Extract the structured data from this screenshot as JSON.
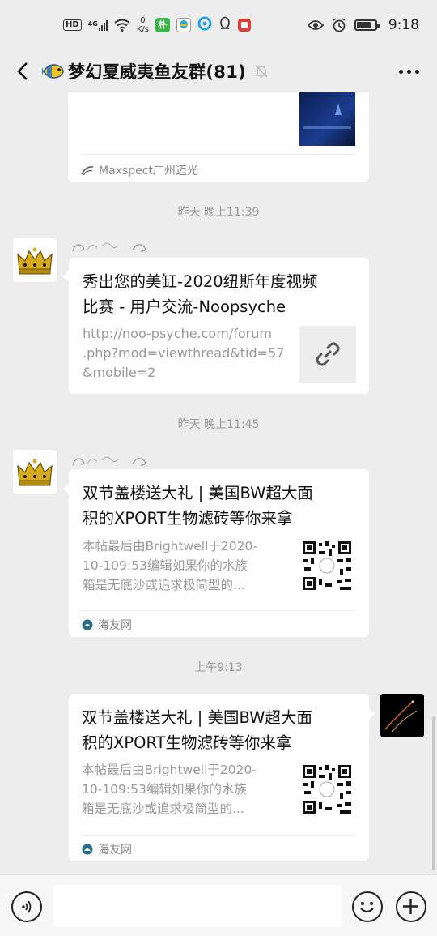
{
  "status_bar": {
    "hd": "HD",
    "net": "4G",
    "speed_value": "0",
    "speed_unit": "K/s",
    "time": "9:18",
    "app_icon_1": "朴"
  },
  "header": {
    "title": "梦幻夏威夷鱼友群(81)",
    "icons": [
      "back-arrow-icon",
      "fish-icon",
      "mute-bell-icon",
      "more-dots-icon"
    ]
  },
  "messages": [
    {
      "type": "partial-card",
      "source": "Maxspect广州迈光"
    },
    {
      "timestamp": "昨天 晚上11:39"
    },
    {
      "type": "link-card",
      "sender_avatar": "crown",
      "title": "秀出您的美缸-2020纽斯年度视频比赛 - 用户交流-Noopsyche",
      "title_line1": "秀出您的美缸-2020纽斯年度视频",
      "title_line2": "比赛 - 用户交流-Noopsyche",
      "desc_line1": "http://noo-psyche.com/forum",
      "desc_line2": ".php?mod=viewthread&tid=57",
      "desc_line3": "&mobile=2",
      "thumb_icon": "link-icon"
    },
    {
      "timestamp": "昨天 晚上11:45"
    },
    {
      "type": "article-card",
      "sender_avatar": "crown",
      "title_line1": "双节盖楼送大礼 | 美国BW超大面",
      "title_line2": "积的XPORT生物滤砖等你来拿",
      "desc_line1": "本帖最后由Brightwell于2020-",
      "desc_line2": "10-109:53编辑如果你的水族",
      "desc_line3": "箱是无底沙或追求极简型的...",
      "source": "海友网"
    },
    {
      "timestamp": "上午9:13"
    },
    {
      "type": "article-card",
      "sender": "self",
      "title_line1": "双节盖楼送大礼 | 美国BW超大面",
      "title_line2": "积的XPORT生物滤砖等你来拿",
      "desc_line1": "本帖最后由Brightwell于2020-",
      "desc_line2": "10-109:53编辑如果你的水族",
      "desc_line3": "箱是无底沙或追求极简型的...",
      "source": "海友网"
    }
  ],
  "input_bar": {
    "placeholder": "",
    "icons": [
      "voice-icon",
      "emoji-icon",
      "plus-icon"
    ]
  },
  "colors": {
    "background": "#ededed",
    "card": "#ffffff",
    "secondary_text": "#999999"
  }
}
